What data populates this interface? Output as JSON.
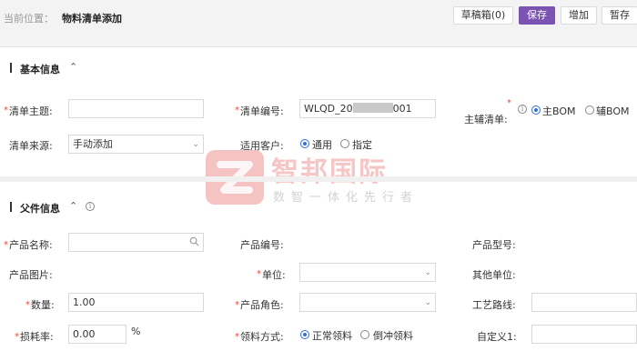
{
  "breadcrumb": {
    "label": "当前位置：",
    "page": "物料清单添加"
  },
  "toolbar": {
    "draft_box": "草稿箱(0)",
    "save": "保存",
    "add": "增加",
    "stash": "暂存"
  },
  "basic_section": {
    "title": "基本信息",
    "bom_title_label": "清单主题:",
    "bom_title_value": "",
    "bom_no_label": "清单编号:",
    "bom_no_value_prefix": "WLQD_20",
    "bom_no_value_suffix": "001",
    "main_aux_label": "主辅清单:",
    "main_aux_options": [
      "主BOM",
      "辅BOM"
    ],
    "source_label": "清单来源:",
    "source_value": "手动添加",
    "customer_label": "适用客户:",
    "customer_options": [
      "通用",
      "指定"
    ]
  },
  "parent_section": {
    "title": "父件信息",
    "product_name_label": "产品名称:",
    "product_name_value": "",
    "product_code_label": "产品编号:",
    "product_model_label": "产品型号:",
    "product_image_label": "产品图片:",
    "unit_label": "单位:",
    "unit_value": "",
    "other_unit_label": "其他单位:",
    "qty_label": "数量:",
    "qty_value": "1.00",
    "role_label": "产品角色:",
    "role_value": "",
    "route_label": "工艺路线:",
    "route_value": "",
    "loss_label": "损耗率:",
    "loss_value": "0.00",
    "loss_unit": "%",
    "pick_label": "领料方式:",
    "pick_options": [
      "正常领料",
      "倒冲领料"
    ],
    "custom1_label": "自定义1:",
    "custom1_value": ""
  },
  "watermark": {
    "brand": "智邦国际",
    "slogan": "数智一体化先行者"
  },
  "colors": {
    "accent": "#7b53b3",
    "radio": "#2f6fde",
    "required": "#e74c3c"
  }
}
